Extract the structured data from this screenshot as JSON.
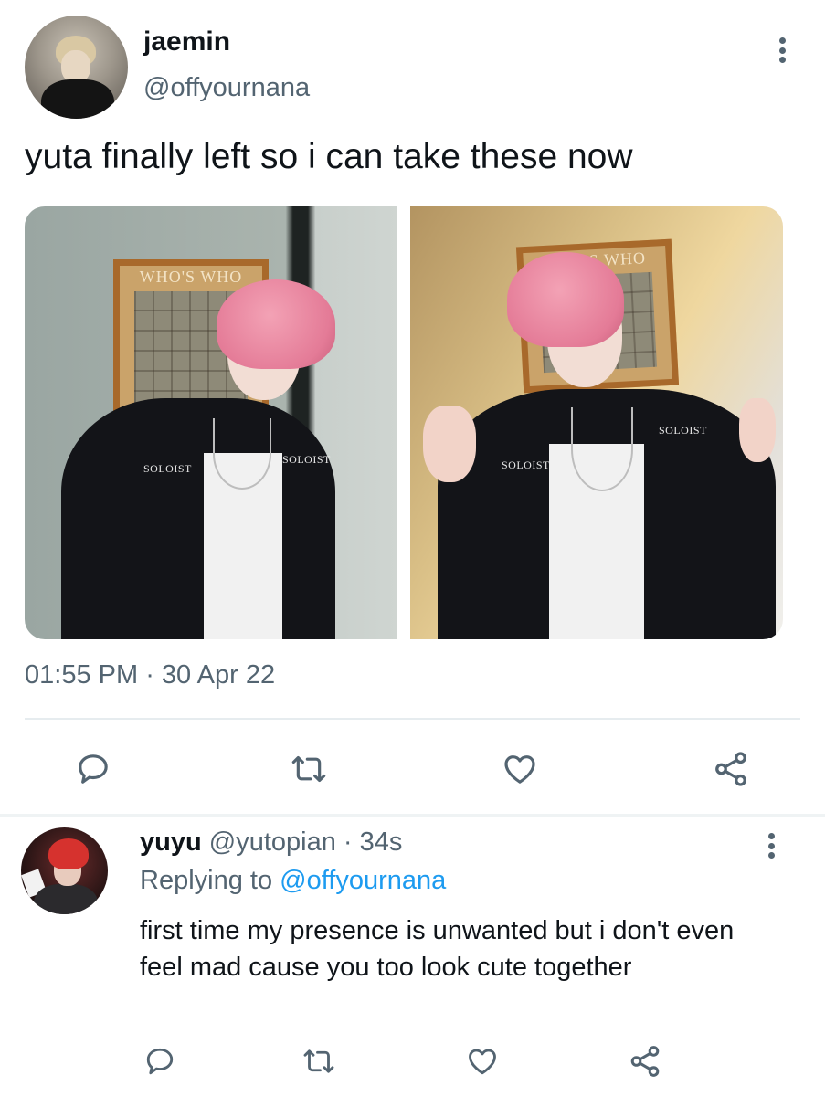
{
  "tweet": {
    "author": {
      "display_name": "jaemin",
      "handle": "@offyournana"
    },
    "text": "yuta finally left so i can take these now",
    "timestamp": "01:55 PM",
    "date_sep": " · ",
    "date": "30 Apr 22",
    "photos": [
      {
        "board_text": "WHO'S WHO",
        "patch_left": "SOLOIST",
        "patch_right": "SOLOIST"
      },
      {
        "board_text": "WHO'S WHO",
        "patch_left": "SOLOIST",
        "patch_right": "SOLOIST"
      }
    ],
    "actions": [
      "reply-icon",
      "retweet-icon",
      "like-icon",
      "share-icon"
    ]
  },
  "reply": {
    "display_name": "yuyu",
    "handle": "@yutopian",
    "sep": " · ",
    "time": "34s",
    "replying_label": "Replying to ",
    "replying_to": "@offyournana",
    "text": "first time my presence is unwanted but i don't even feel mad cause you too look cute together",
    "actions": [
      "reply-icon",
      "retweet-icon",
      "like-icon",
      "share-icon"
    ]
  },
  "colors": {
    "text_primary": "#0f1419",
    "text_secondary": "#536471",
    "link": "#1d9bf0",
    "divider": "#e6ecef"
  }
}
